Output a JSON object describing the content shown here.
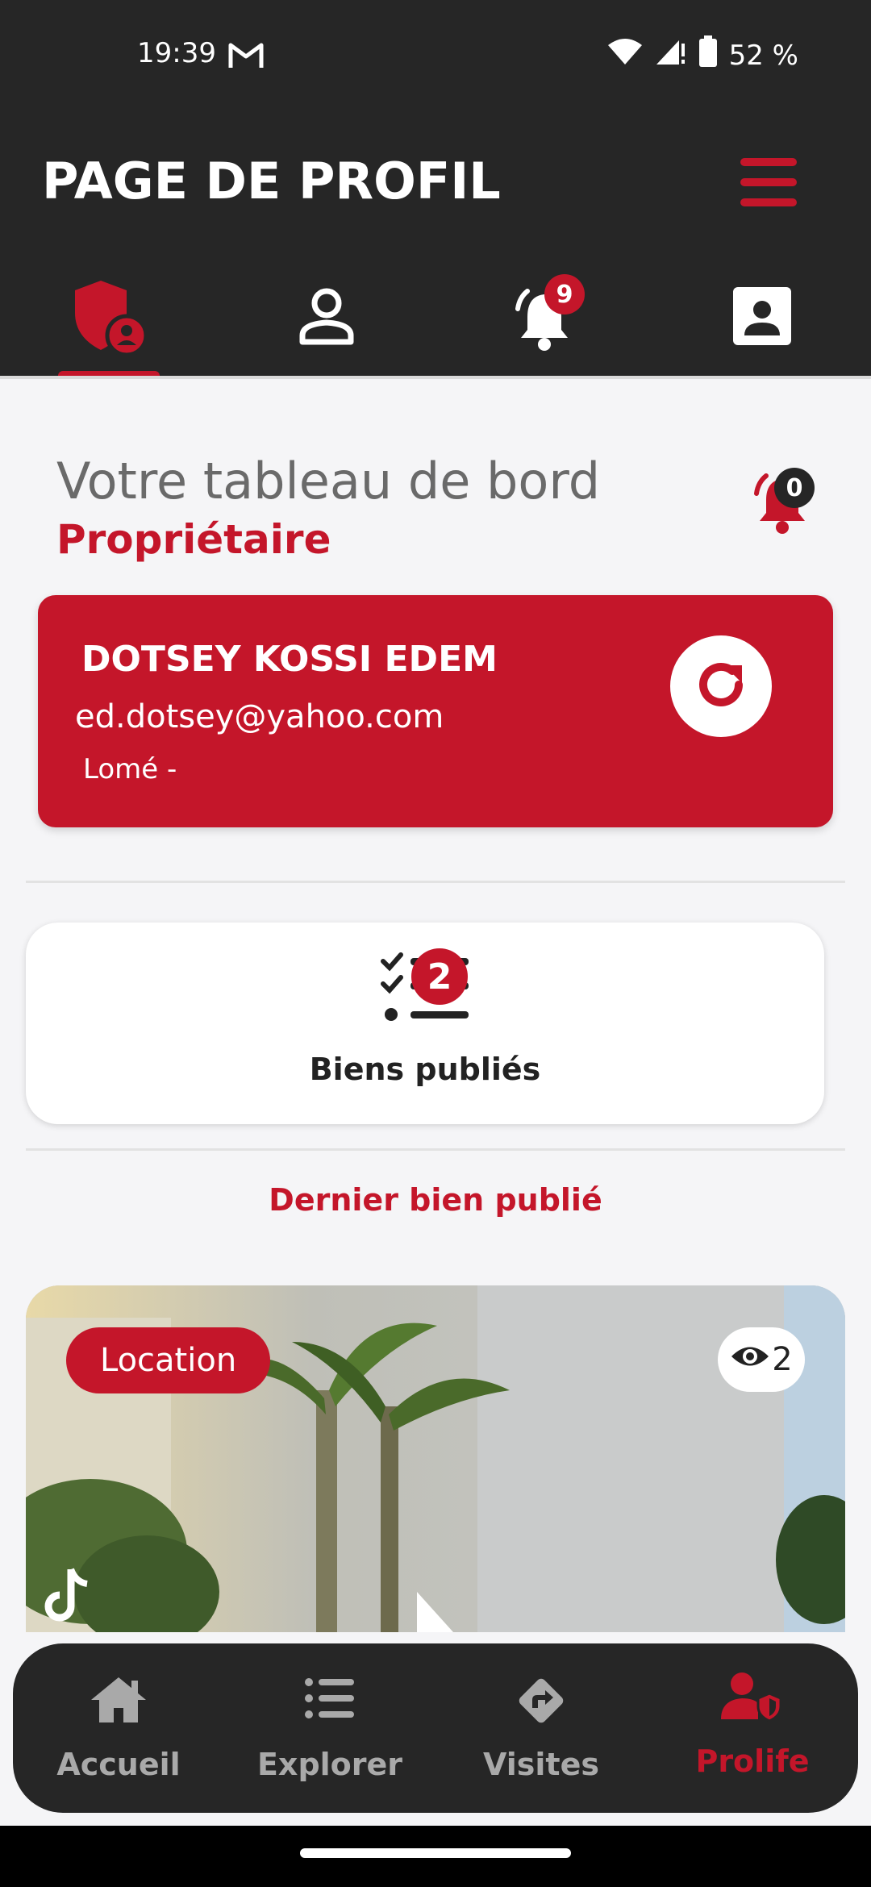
{
  "status_bar": {
    "time": "19:39",
    "battery": "52 %",
    "icons": [
      "gmail-icon",
      "wifi-icon",
      "signal-icon",
      "battery-icon"
    ]
  },
  "header": {
    "title": "PAGE DE PROFIL",
    "menu_icon": "hamburger-menu-icon",
    "tabs": [
      {
        "icon": "shield-user-icon",
        "active": true
      },
      {
        "icon": "user-outline-icon",
        "active": false
      },
      {
        "icon": "bell-ringing-icon",
        "badge": "9",
        "active": false
      },
      {
        "icon": "contact-card-icon",
        "active": false
      }
    ]
  },
  "dashboard": {
    "title": "Votre tableau de bord",
    "role": "Propriétaire",
    "notif_count": "0"
  },
  "user": {
    "name": "DOTSEY KOSSI EDEM",
    "email": "ed.dotsey@yahoo.com",
    "location": "Lomé  -"
  },
  "stats": {
    "published_count": "2",
    "published_label": "Biens publiés"
  },
  "last_published": {
    "title": "Dernier bien publié",
    "type_label": "Location",
    "views": "2"
  },
  "bottom_nav": [
    {
      "label": "Accueil",
      "icon": "home-icon",
      "active": false
    },
    {
      "label": "Explorer",
      "icon": "list-icon",
      "active": false
    },
    {
      "label": "Visites",
      "icon": "directions-icon",
      "active": false
    },
    {
      "label": "Prolife",
      "icon": "user-shield-icon",
      "active": true
    }
  ],
  "colors": {
    "accent": "#c4162a",
    "dark": "#262626",
    "background": "#f5f5f7"
  }
}
